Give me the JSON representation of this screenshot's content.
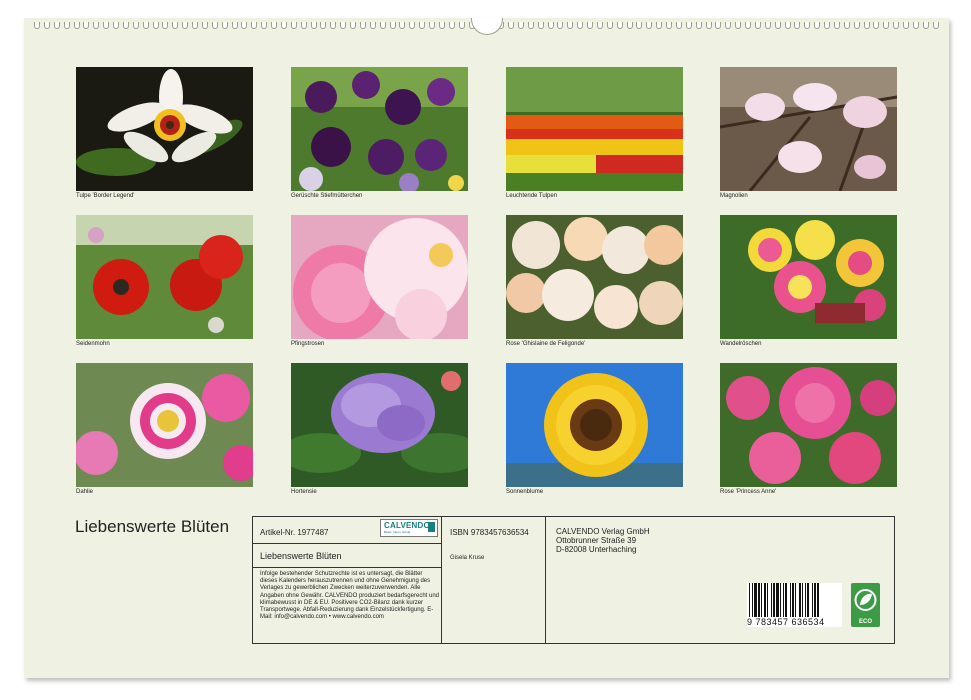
{
  "calendar": {
    "title": "Liebenswerte Blüten"
  },
  "photos": [
    {
      "caption": "Tulpe 'Border Legend'",
      "subject": "white-red tulip"
    },
    {
      "caption": "Gerüschte Stiefmütterchen",
      "subject": "purple pansies"
    },
    {
      "caption": "Leuchtende Tulpen",
      "subject": "tulip field"
    },
    {
      "caption": "Magnolien",
      "subject": "pink magnolia"
    },
    {
      "caption": "Seidenmohn",
      "subject": "red poppies"
    },
    {
      "caption": "Pfingstrosen",
      "subject": "pink peonies"
    },
    {
      "caption": "Rose 'Ghislaine de Feligonde'",
      "subject": "peach roses"
    },
    {
      "caption": "Wandelröschen",
      "subject": "lantana"
    },
    {
      "caption": "Dahlie",
      "subject": "pink dahlia"
    },
    {
      "caption": "Hortensie",
      "subject": "purple hydrangea"
    },
    {
      "caption": "Sonnenblume",
      "subject": "sunflower"
    },
    {
      "caption": "Rose 'Princess Anne'",
      "subject": "pink roses"
    }
  ],
  "infobox": {
    "article": "Artikel-Nr. 1977487",
    "logo_text": "CALVENDO",
    "logo_sub": "Bilder. Ideen. Erfolg.",
    "product_title": "Liebenswerte Blüten",
    "legal": "Infolge bestehender Schutzrechte ist es untersagt, die Blätter dieses Kalenders herauszutrennen und ohne Genehmigung des Verlages zu gewerblichen Zwecken weiterzuverwenden. Alle Angaben ohne Gewähr. CALVENDO produziert bedarfsgerecht und klimabewusst in DE & EU. Positivere CO2-Bilanz dank kurzer Transportwege. Abfall-Reduzierung dank Einzelstückfertigung. E-Mail: info@calvendo.com • www.calvendo.com",
    "isbn": "ISBN 9783457636534",
    "author": "Gisela Kruse",
    "publisher_name": "CALVENDO Verlag GmbH",
    "publisher_street": "Ottobrunner Straße 39",
    "publisher_city": "D-82008 Unterhaching",
    "barcode_number": "9 783457 636534",
    "eco_label": "ECO"
  }
}
